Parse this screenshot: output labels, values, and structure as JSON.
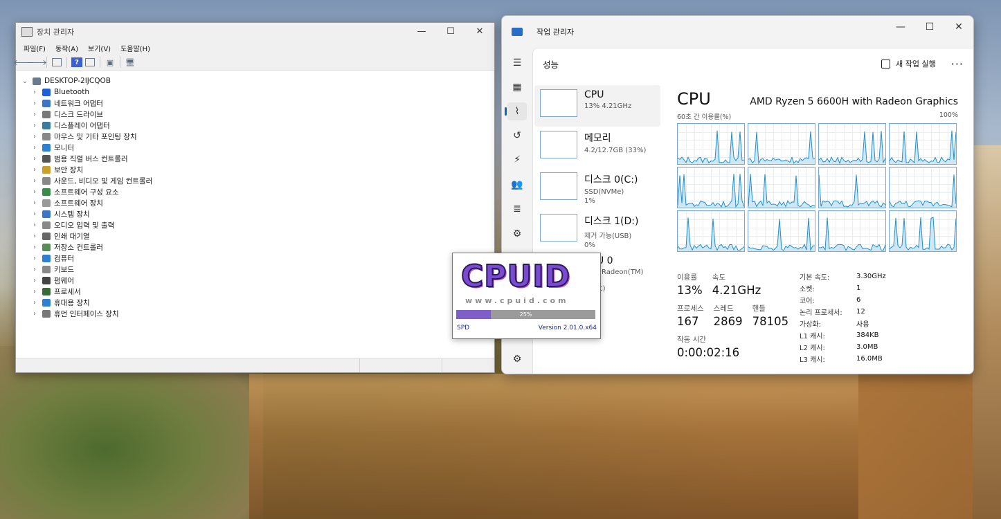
{
  "device_manager": {
    "title": "장치 관리자",
    "menu": [
      "파일(F)",
      "동작(A)",
      "보기(V)",
      "도움말(H)"
    ],
    "root": "DESKTOP-2IJCQOB",
    "items": [
      {
        "label": "Bluetooth",
        "icon": "bluetooth-icon",
        "color": "#1e5fd8"
      },
      {
        "label": "네트워크 어댑터",
        "icon": "network-adapter-icon",
        "color": "#3a76c4"
      },
      {
        "label": "디스크 드라이브",
        "icon": "disk-drive-icon",
        "color": "#777777"
      },
      {
        "label": "디스플레이 어댑터",
        "icon": "display-adapter-icon",
        "color": "#3b7a9a"
      },
      {
        "label": "마우스 및 기타 포인팅 장치",
        "icon": "mouse-icon",
        "color": "#888888"
      },
      {
        "label": "모니터",
        "icon": "monitor-icon",
        "color": "#2f7fd0"
      },
      {
        "label": "범용 직렬 버스 컨트롤러",
        "icon": "usb-icon",
        "color": "#555555"
      },
      {
        "label": "보안 장치",
        "icon": "security-device-icon",
        "color": "#c8a02a"
      },
      {
        "label": "사운드, 비디오 및 게임 컨트롤러",
        "icon": "sound-icon",
        "color": "#888888"
      },
      {
        "label": "소프트웨어 구성 요소",
        "icon": "software-component-icon",
        "color": "#3a8a4a"
      },
      {
        "label": "소프트웨어 장치",
        "icon": "software-device-icon",
        "color": "#999999"
      },
      {
        "label": "시스템 장치",
        "icon": "system-device-icon",
        "color": "#3a76c4"
      },
      {
        "label": "오디오 입력 및 출력",
        "icon": "audio-icon",
        "color": "#888888"
      },
      {
        "label": "인쇄 대기열",
        "icon": "printer-icon",
        "color": "#666666"
      },
      {
        "label": "저장소 컨트롤러",
        "icon": "storage-controller-icon",
        "color": "#5a8a5a"
      },
      {
        "label": "컴퓨터",
        "icon": "computer-icon",
        "color": "#2f7fd0"
      },
      {
        "label": "키보드",
        "icon": "keyboard-icon",
        "color": "#888888"
      },
      {
        "label": "펌웨어",
        "icon": "firmware-icon",
        "color": "#444444"
      },
      {
        "label": "프로세서",
        "icon": "processor-icon",
        "color": "#3a6a3a"
      },
      {
        "label": "휴대용 장치",
        "icon": "portable-device-icon",
        "color": "#2f7fd0"
      },
      {
        "label": "휴먼 인터페이스 장치",
        "icon": "hid-icon",
        "color": "#777777"
      }
    ]
  },
  "task_manager": {
    "title": "작업 관리자",
    "section": "성능",
    "run_task": "새 작업 실행",
    "more": "···",
    "perf_items": [
      {
        "name": "CPU",
        "sub": "13% 4.21GHz",
        "sub2": "",
        "selected": true
      },
      {
        "name": "메모리",
        "sub": "4.2/12.7GB (33%)",
        "sub2": "",
        "selected": false
      },
      {
        "name": "디스크 0(C:)",
        "sub": "SSD(NVMe)",
        "sub2": "1%",
        "selected": false
      },
      {
        "name": "디스크 1(D:)",
        "sub": "제거 가능(USB)",
        "sub2": "0%",
        "selected": false
      },
      {
        "name": "GPU 0",
        "sub": "AMD Radeon(TM) Grap",
        "sub2": "53 °C)",
        "selected": false
      }
    ],
    "cpu": {
      "heading": "CPU",
      "model": "AMD Ryzen 5 6600H with Radeon Graphics",
      "graph_caption": "60초 간 이용률(%)",
      "graph_max": "100%",
      "utilization_label": "이용률",
      "utilization": "13%",
      "speed_label": "속도",
      "speed": "4.21GHz",
      "processes_label": "프로세스",
      "processes": "167",
      "threads_label": "스레드",
      "threads": "2869",
      "handles_label": "핸들",
      "handles": "78105",
      "uptime_label": "작동 시간",
      "uptime": "0:00:02:16",
      "specs": [
        {
          "k": "기본 속도:",
          "v": "3.30GHz"
        },
        {
          "k": "소켓:",
          "v": "1"
        },
        {
          "k": "코어:",
          "v": "6"
        },
        {
          "k": "논리 프로세서:",
          "v": "12"
        },
        {
          "k": "가상화:",
          "v": "사용"
        },
        {
          "k": "L1 캐시:",
          "v": "384KB"
        },
        {
          "k": "L2 캐시:",
          "v": "3.0MB"
        },
        {
          "k": "L3 캐시:",
          "v": "16.0MB"
        }
      ]
    }
  },
  "cpuid": {
    "logo": "CPUID",
    "url": "www.cpuid.com",
    "progress": 25,
    "progress_label": "25%",
    "left_label": "SPD",
    "version": "Version 2.01.0.x64"
  },
  "colors": {
    "accent": "#0a64c8",
    "graph_line": "#1f8fc9",
    "graph_fill": "#cfe6f4"
  }
}
